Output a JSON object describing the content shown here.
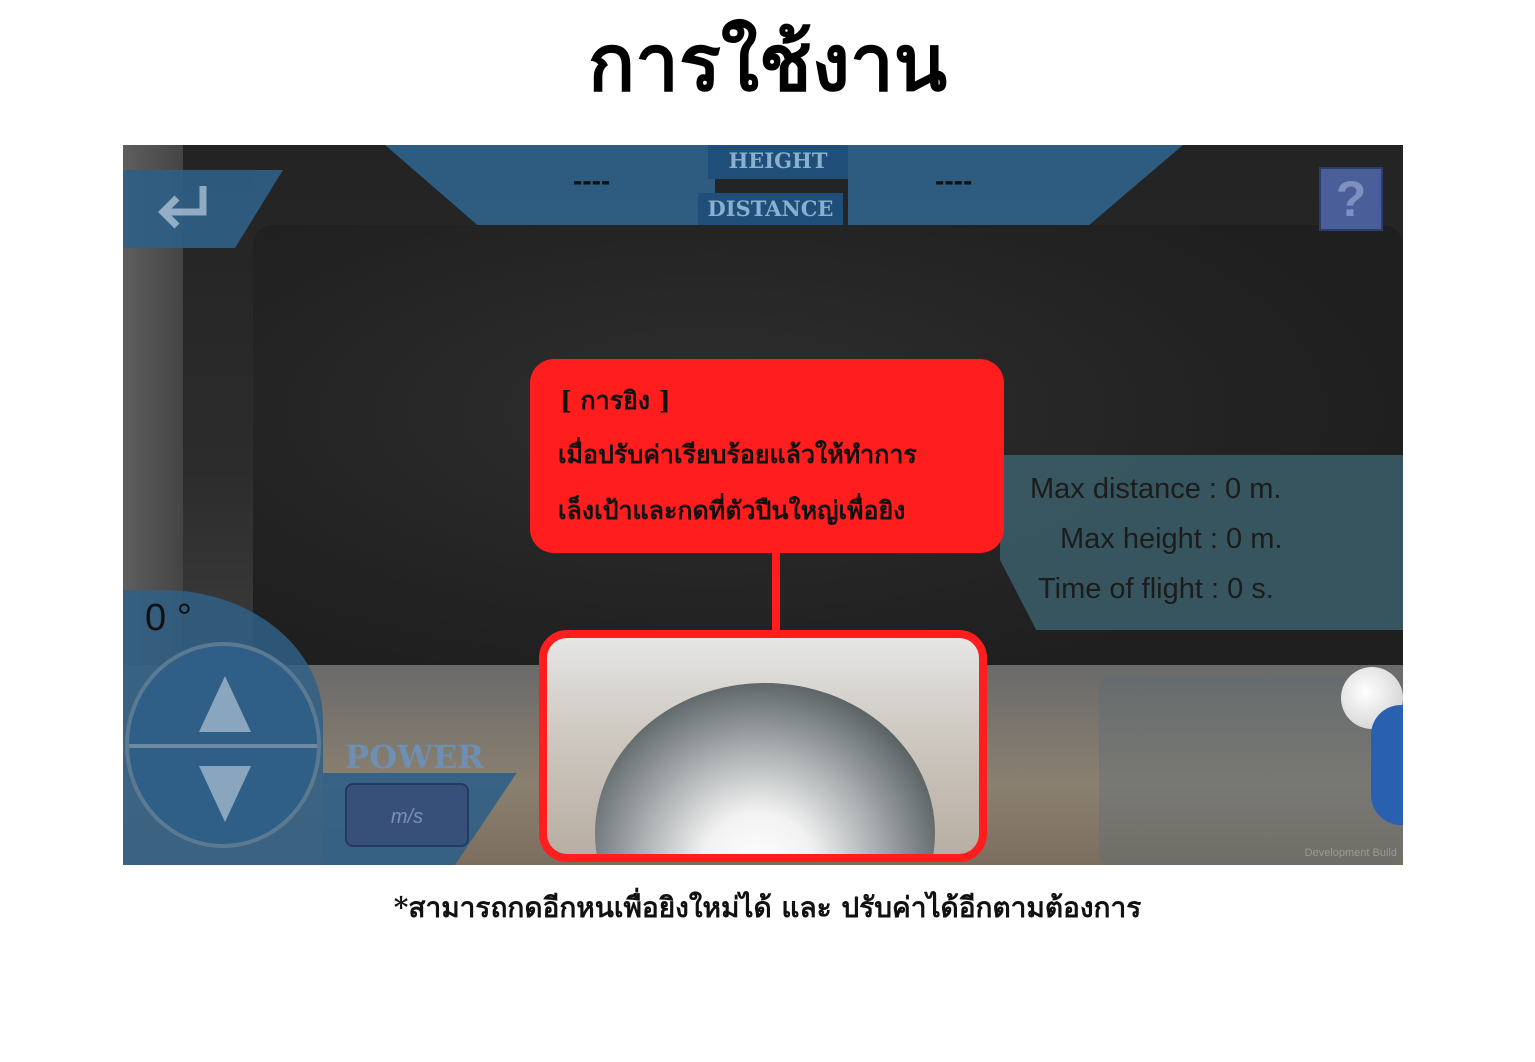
{
  "page": {
    "title": "การใช้งาน",
    "footnote": "*สามารถกดอีกหนเพื่อยิงใหม่ได้ และ ปรับค่าได้อีกตามต้องการ"
  },
  "hud": {
    "height_label": "HEIGHT",
    "distance_label": "DISTANCE",
    "height_value": "----",
    "distance_value": "----",
    "help_label": "?",
    "back_icon": "return-arrow-icon"
  },
  "stats": {
    "max_distance": "Max distance : 0 m.",
    "max_height": "Max height : 0 m.",
    "time_of_flight": "Time of flight : 0 s."
  },
  "controls": {
    "angle": "0 °",
    "power_label": "POWER",
    "power_placeholder": "m/s",
    "up_icon": "triangle-up-icon",
    "down_icon": "triangle-down-icon"
  },
  "callout": {
    "title": "[ การยิง ]",
    "line1": "เมื่อปรับค่าเรียบร้อยแล้วให้ทำการ",
    "line2": "เล็งเป้าและกดที่ตัวปืนใหญ่เพื่อยิง"
  },
  "watermark": "Development Build",
  "colors": {
    "hud_blue": "#2f5f86",
    "callout_red": "#ff1d1d",
    "stats_panel": "#3a5a64"
  }
}
